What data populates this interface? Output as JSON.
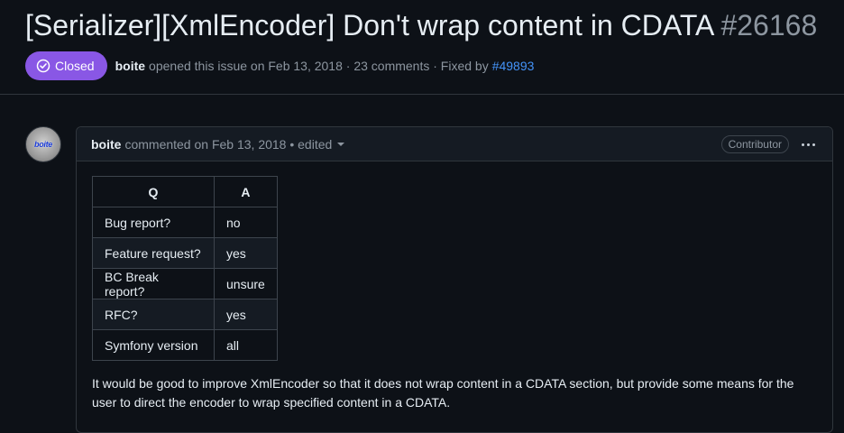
{
  "issue": {
    "title": "[Serializer][XmlEncoder] Don't wrap content in CDATA",
    "number": "#26168",
    "state": "Closed",
    "author": "boite",
    "opened_text": "opened this issue on Feb 13, 2018 · 23 comments · Fixed by",
    "fixed_by": "#49893"
  },
  "comment": {
    "avatar_text": "boite",
    "author": "boite",
    "meta": "commented on Feb 13, 2018 • edited",
    "role": "Contributor",
    "table": {
      "headers": [
        "Q",
        "A"
      ],
      "rows": [
        [
          "Bug report?",
          "no"
        ],
        [
          "Feature request?",
          "yes"
        ],
        [
          "BC Break report?",
          "unsure"
        ],
        [
          "RFC?",
          "yes"
        ],
        [
          "Symfony version",
          "all"
        ]
      ]
    },
    "body": "It would be good to improve XmlEncoder so that it does not wrap content in a CDATA section, but provide some means for the user to direct the encoder to wrap specified content in a CDATA."
  },
  "colors": {
    "closed_badge": "#8957e5",
    "link": "#4493f8",
    "background": "#0d1117"
  }
}
